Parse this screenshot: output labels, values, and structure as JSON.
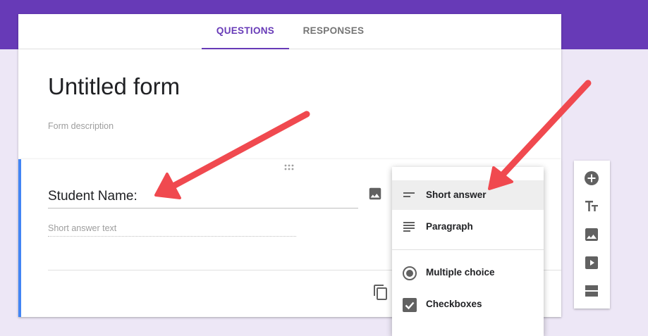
{
  "tabs": {
    "questions": "QUESTIONS",
    "responses": "RESPONSES"
  },
  "form": {
    "title": "Untitled form",
    "description_placeholder": "Form description"
  },
  "question": {
    "title": "Student Name:",
    "answer_placeholder": "Short answer text"
  },
  "type_menu": {
    "items": [
      {
        "label": "Short answer",
        "icon": "short-answer-icon",
        "selected": true
      },
      {
        "label": "Paragraph",
        "icon": "paragraph-icon"
      },
      {
        "label": "Multiple choice",
        "icon": "radio-button-icon"
      },
      {
        "label": "Checkboxes",
        "icon": "checkbox-icon"
      }
    ]
  },
  "side_toolbar": {
    "tools": [
      "add-question-icon",
      "add-title-icon",
      "add-image-icon",
      "add-video-icon",
      "add-section-icon"
    ]
  },
  "colors": {
    "header": "#673ab7",
    "background": "#ede7f6",
    "accent": "#4285f4",
    "annotation_arrow": "#f0494f"
  }
}
